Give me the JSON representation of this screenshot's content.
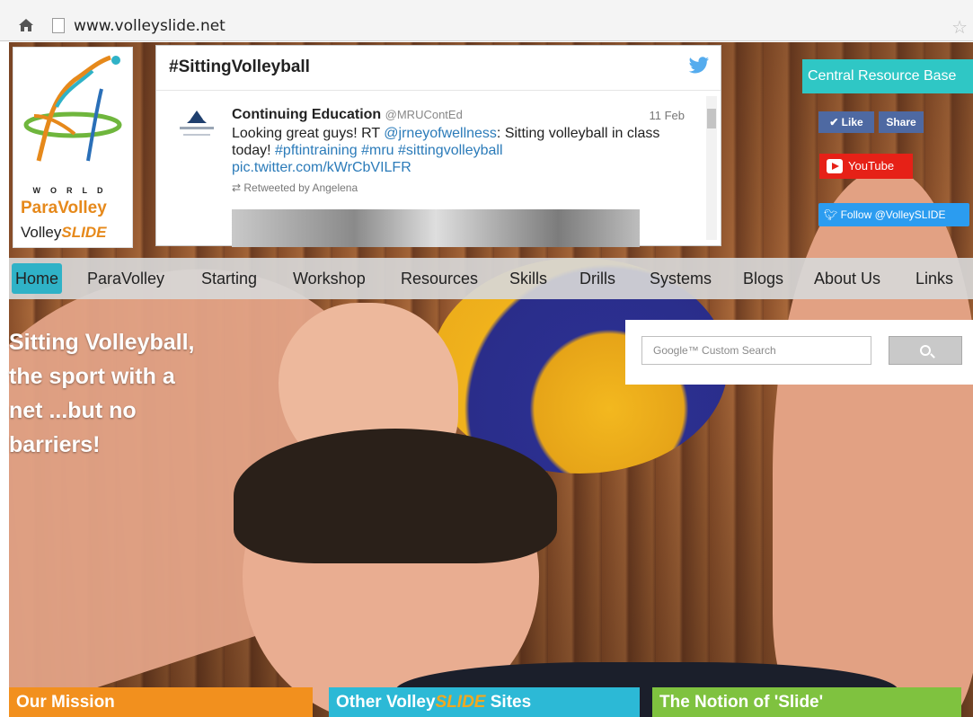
{
  "browser": {
    "url": "www.volleyslide.net"
  },
  "logo": {
    "world": "WORLD",
    "paravolley": "ParaVolley",
    "volley": "Volley",
    "slide": "SLIDE"
  },
  "twitter_widget": {
    "title": "#SittingVolleyball",
    "tweet": {
      "author": "Continuing Education",
      "handle": "@MRUContEd",
      "date": "11 Feb",
      "text_1": "Looking great guys! RT ",
      "mention": "@jrneyofwellness",
      "text_2": ": Sitting volleyball in class today! ",
      "hashtags": "#pftintraining #mru #sittingvolleyball",
      "pic_link": "pic.twitter.com/kWrCbVILFR",
      "retweeted_by": "Retweeted by Angelena"
    }
  },
  "social": {
    "central_resource": "Central Resource Base",
    "like": "✔ Like",
    "share": "Share",
    "youtube": "YouTube",
    "follow": "Follow @VolleySLIDE"
  },
  "nav": {
    "items": [
      {
        "label": "Home",
        "active": true
      },
      {
        "label": "ParaVolley"
      },
      {
        "label": "Starting"
      },
      {
        "label": "Workshop"
      },
      {
        "label": "Resources"
      },
      {
        "label": "Skills"
      },
      {
        "label": "Drills"
      },
      {
        "label": "Systems"
      },
      {
        "label": "Blogs"
      },
      {
        "label": "About Us"
      },
      {
        "label": "Links"
      }
    ]
  },
  "hero": {
    "line1": "Sitting Volleyball,",
    "line2": "the sport with a",
    "line3": "net ...but no",
    "line4": "barriers!"
  },
  "search": {
    "placeholder": "Google™ Custom Search"
  },
  "tiles": {
    "mission": "Our Mission",
    "sites_prefix": "Other Volley",
    "sites_slide": "SLIDE",
    "sites_suffix": " Sites",
    "notion": "The Notion of 'Slide'"
  },
  "colors": {
    "accent_teal": "#2fb2c7",
    "orange": "#f2901e",
    "green": "#7fc23f",
    "youtube_red": "#e62117",
    "facebook_blue": "#4e69a2",
    "twitter_blue": "#2b9cf0"
  }
}
